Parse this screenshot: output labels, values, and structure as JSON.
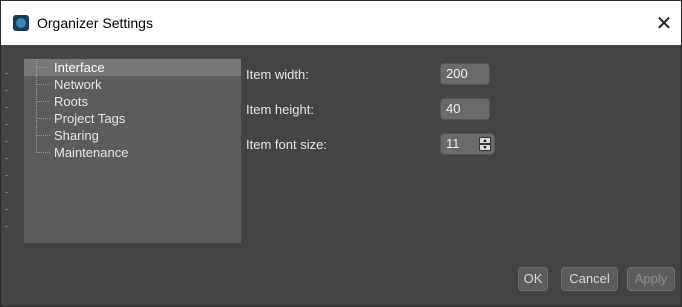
{
  "window": {
    "title": "Organizer Settings",
    "close_glyph": "✕"
  },
  "tree": {
    "items": [
      {
        "label": "Interface",
        "selected": true
      },
      {
        "label": "Network",
        "selected": false
      },
      {
        "label": "Roots",
        "selected": false
      },
      {
        "label": "Project Tags",
        "selected": false
      },
      {
        "label": "Sharing",
        "selected": false
      },
      {
        "label": "Maintenance",
        "selected": false
      }
    ]
  },
  "form": {
    "item_width": {
      "label": "Item width:",
      "value": "200"
    },
    "item_height": {
      "label": "Item height:",
      "value": "40"
    },
    "item_font_size": {
      "label": "Item font size:",
      "value": "11"
    }
  },
  "buttons": {
    "ok": "OK",
    "cancel": "Cancel",
    "apply": "Apply"
  },
  "icons": {
    "app": "organizer-app-icon",
    "close": "close-icon",
    "spin_up": "chevron-up-icon",
    "spin_down": "chevron-down-icon"
  }
}
